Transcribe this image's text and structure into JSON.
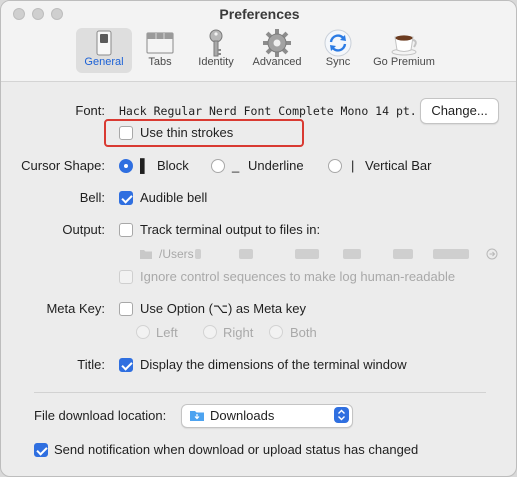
{
  "window": {
    "title": "Preferences"
  },
  "tabs": [
    {
      "label": "General",
      "icon": "general-switch-icon"
    },
    {
      "label": "Tabs",
      "icon": "tabs-icon"
    },
    {
      "label": "Identity",
      "icon": "key-icon"
    },
    {
      "label": "Advanced",
      "icon": "gear-icon"
    },
    {
      "label": "Sync",
      "icon": "sync-icon"
    },
    {
      "label": "Go Premium",
      "icon": "coffee-cup-icon"
    }
  ],
  "font": {
    "label": "Font:",
    "value": "Hack Regular Nerd Font Complete Mono 14 pt.",
    "change_button": "Change...",
    "thin_strokes": "Use thin strokes",
    "thin_strokes_checked": false
  },
  "cursor": {
    "label": "Cursor Shape:",
    "options": [
      "Block",
      "Underline",
      "Vertical Bar"
    ],
    "glyphs": [
      "▌",
      "_",
      "|"
    ],
    "selected": "Block"
  },
  "bell": {
    "label": "Bell:",
    "option": "Audible bell",
    "checked": true
  },
  "output": {
    "label": "Output:",
    "track": "Track terminal output to files in:",
    "track_checked": false,
    "path_prefix": "/Users",
    "ignore_sequences": "Ignore control sequences to make log human-readable"
  },
  "meta_key": {
    "label": "Meta Key:",
    "option": "Use Option (⌥) as Meta key",
    "checked": false,
    "sides": [
      "Left",
      "Right",
      "Both"
    ]
  },
  "title_setting": {
    "label": "Title:",
    "option": "Display the dimensions of the terminal window",
    "checked": true
  },
  "download": {
    "label": "File download location:",
    "folder": "Downloads",
    "notify": "Send notification when download or upload status has changed",
    "notify_checked": true
  },
  "colors": {
    "accent": "#2f6fe0",
    "highlight_box": "#d93a32"
  }
}
